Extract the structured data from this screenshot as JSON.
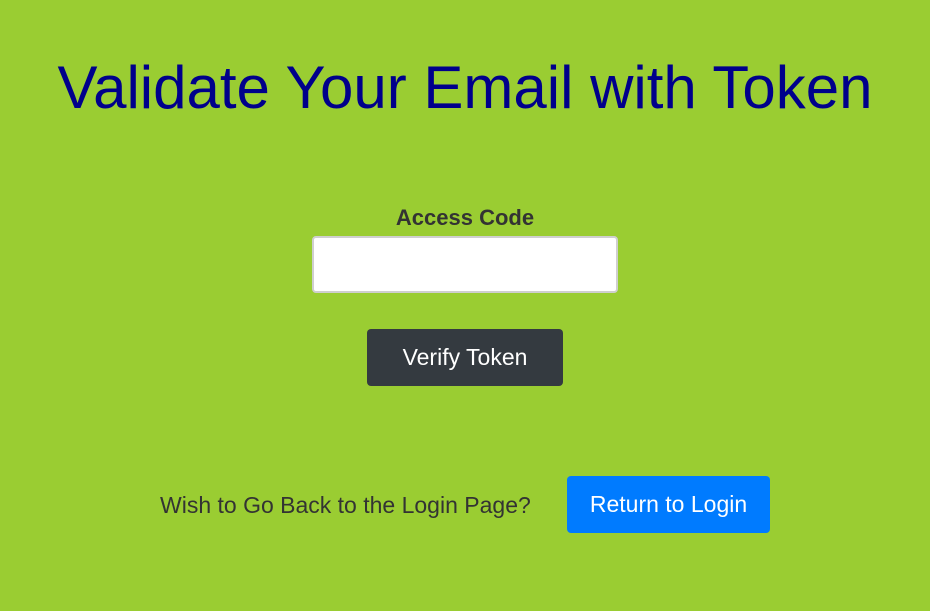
{
  "page": {
    "title": "Validate Your Email with Token",
    "background_color": "#9acd32",
    "title_color": "#00008b"
  },
  "form": {
    "field_label": "Access Code",
    "input_value": "",
    "input_placeholder": "",
    "verify_button_label": "Verify Token",
    "verify_button_color": "#343a40"
  },
  "footer": {
    "prompt_text": "Wish to Go Back to the Login Page?",
    "login_button_label": "Return to Login",
    "login_button_color": "#007bff"
  }
}
